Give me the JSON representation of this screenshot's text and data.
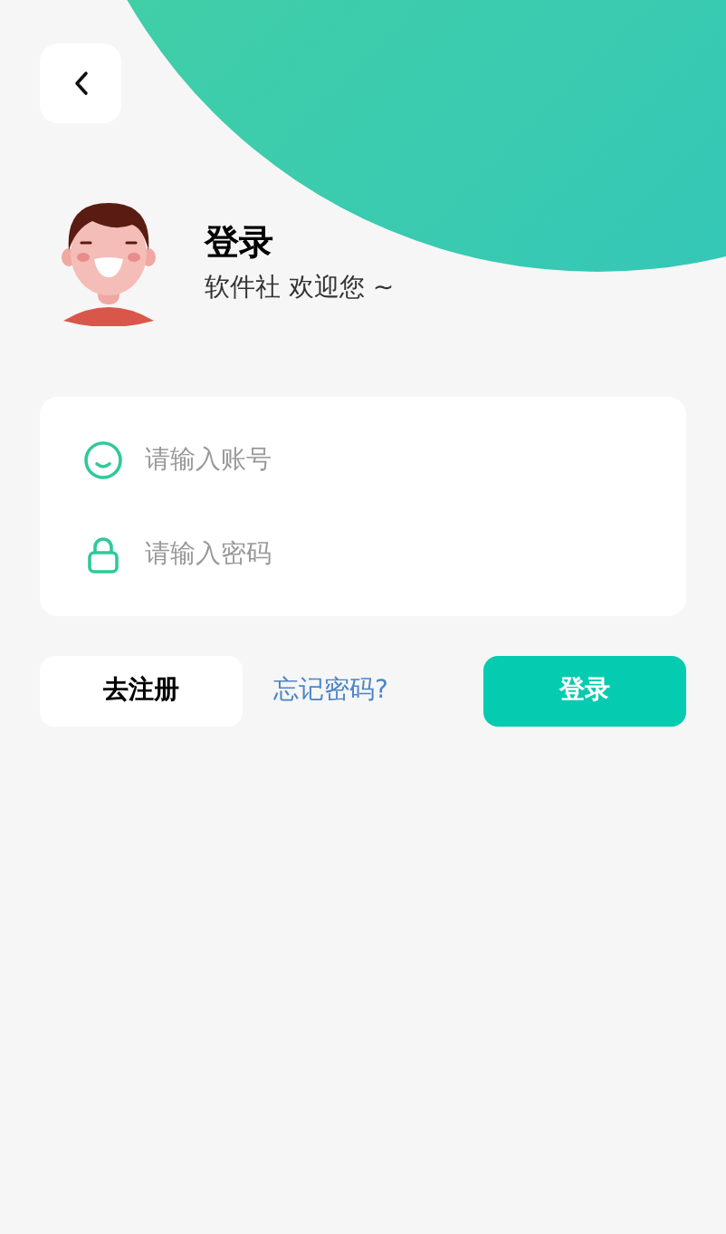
{
  "header": {
    "title": "登录",
    "subtitle": "软件社 欢迎您 ~"
  },
  "form": {
    "fields": [
      {
        "kind": "account",
        "placeholder": "请输入账号"
      },
      {
        "kind": "password",
        "placeholder": "请输入密码"
      }
    ]
  },
  "actions": {
    "register": "去注册",
    "forgot": "忘记密码?",
    "login": "登录"
  }
}
